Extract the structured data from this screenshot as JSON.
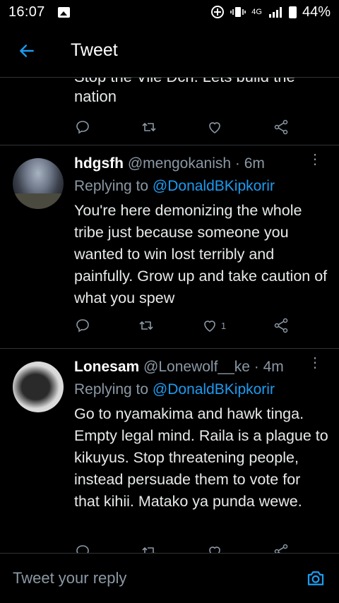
{
  "status_bar": {
    "time": "16:07",
    "network": "4G",
    "battery": "44%"
  },
  "header": {
    "title": "Tweet"
  },
  "partial_tweet": {
    "cut_text": "Stop the Vile Dch. Lets build the",
    "text_end": "nation"
  },
  "replies": [
    {
      "name": "hdgsfh",
      "handle_time": "@mengokanish · 6m",
      "replying_label": "Replying to",
      "replying_to": "@DonaldBKipkorir",
      "text": "You're here demonizing the whole tribe just because someone you wanted to win lost terribly and painfully. Grow up and take caution of what you spew",
      "like_count": "1"
    },
    {
      "name": "Lonesam",
      "handle_time": "@Lonewolf__ke · 4m",
      "replying_label": "Replying to",
      "replying_to": "@DonaldBKipkorir",
      "text": "Go to nyamakima and hawk tinga. Empty legal mind. Raila is a plague to kikuyus. Stop threatening people, instead persuade them to vote for that kihii. Matako ya punda wewe.",
      "like_count": ""
    }
  ],
  "composer": {
    "placeholder": "Tweet your reply"
  },
  "colors": {
    "accent": "#1d9bf0",
    "background": "#000000",
    "muted": "#8b98a5"
  }
}
